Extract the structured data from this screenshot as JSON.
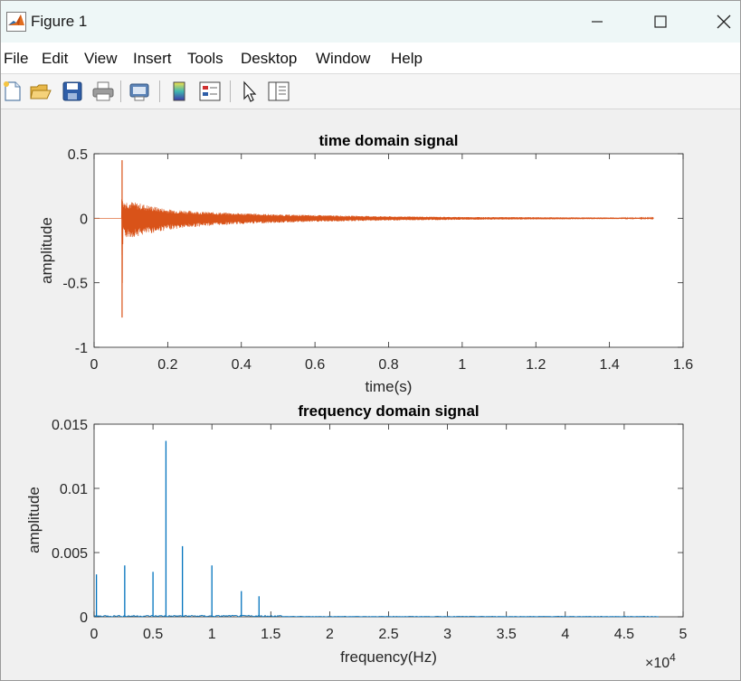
{
  "window": {
    "title": "Figure 1",
    "icon": "matlab-logo-icon",
    "controls": [
      "minimize-icon",
      "maximize-icon",
      "close-icon"
    ]
  },
  "menu": {
    "items": [
      "File",
      "Edit",
      "View",
      "Insert",
      "Tools",
      "Desktop",
      "Window",
      "Help"
    ]
  },
  "toolbar": {
    "buttons": [
      "new-figure-icon",
      "open-file-icon",
      "save-icon",
      "print-icon",
      "print-preview-icon",
      "colorbar-icon",
      "legend-icon",
      "pointer-icon",
      "property-inspector-icon"
    ]
  },
  "colors": {
    "time_series": "#d95319",
    "freq_series": "#0072bd",
    "axes": "#262626",
    "figure_bg": "#f0f0f0"
  },
  "chart_data": [
    {
      "type": "line",
      "title": "time domain signal",
      "xlabel": "time(s)",
      "ylabel": "amplitude",
      "xlim": [
        0,
        1.6
      ],
      "ylim": [
        -1,
        0.5
      ],
      "xticks": [
        "0",
        "0.2",
        "0.4",
        "0.6",
        "0.8",
        "1",
        "1.2",
        "1.4",
        "1.6"
      ],
      "yticks": [
        "-1",
        "-0.5",
        "0",
        "0.5"
      ],
      "grid": false,
      "series": [
        {
          "color": "#d95319",
          "description_points": {
            "x": [
              0,
              0.074,
              0.076,
              0.078,
              0.08,
              0.1,
              0.15,
              0.2,
              0.3,
              0.4,
              0.5,
              0.6,
              0.8,
              1.0,
              1.2,
              1.4,
              1.52
            ],
            "y_max": [
              0,
              0,
              0.45,
              0.1,
              0.14,
              0.13,
              0.1,
              0.07,
              0.05,
              0.04,
              0.03,
              0.025,
              0.015,
              0.01,
              0.008,
              0.006,
              0.004
            ],
            "y_min": [
              0,
              0,
              -0.77,
              -0.1,
              -0.15,
              -0.15,
              -0.12,
              -0.09,
              -0.06,
              -0.045,
              -0.035,
              -0.028,
              -0.018,
              -0.012,
              -0.009,
              -0.006,
              -0.004
            ]
          }
        }
      ]
    },
    {
      "type": "line",
      "title": "frequency domain signal",
      "xlabel": "frequency(Hz)",
      "ylabel": "amplitude",
      "xlim": [
        0,
        5
      ],
      "ylim": [
        0,
        0.015
      ],
      "x_exponent": "×10^4",
      "exponent_base": "×10",
      "exponent_power": "4",
      "xticks": [
        "0",
        "0.5",
        "1",
        "1.5",
        "2",
        "2.5",
        "3",
        "3.5",
        "4",
        "4.5",
        "5"
      ],
      "yticks": [
        "0",
        "0.005",
        "0.01",
        "0.015"
      ],
      "grid": false,
      "series": [
        {
          "color": "#0072bd",
          "x_end": 4.8,
          "peaks": {
            "x": [
              0.02,
              0.26,
              0.5,
              0.61,
              0.75,
              1.0,
              1.25,
              1.4
            ],
            "y": [
              0.0033,
              0.004,
              0.0035,
              0.0137,
              0.0055,
              0.004,
              0.002,
              0.0016
            ]
          }
        }
      ]
    }
  ]
}
